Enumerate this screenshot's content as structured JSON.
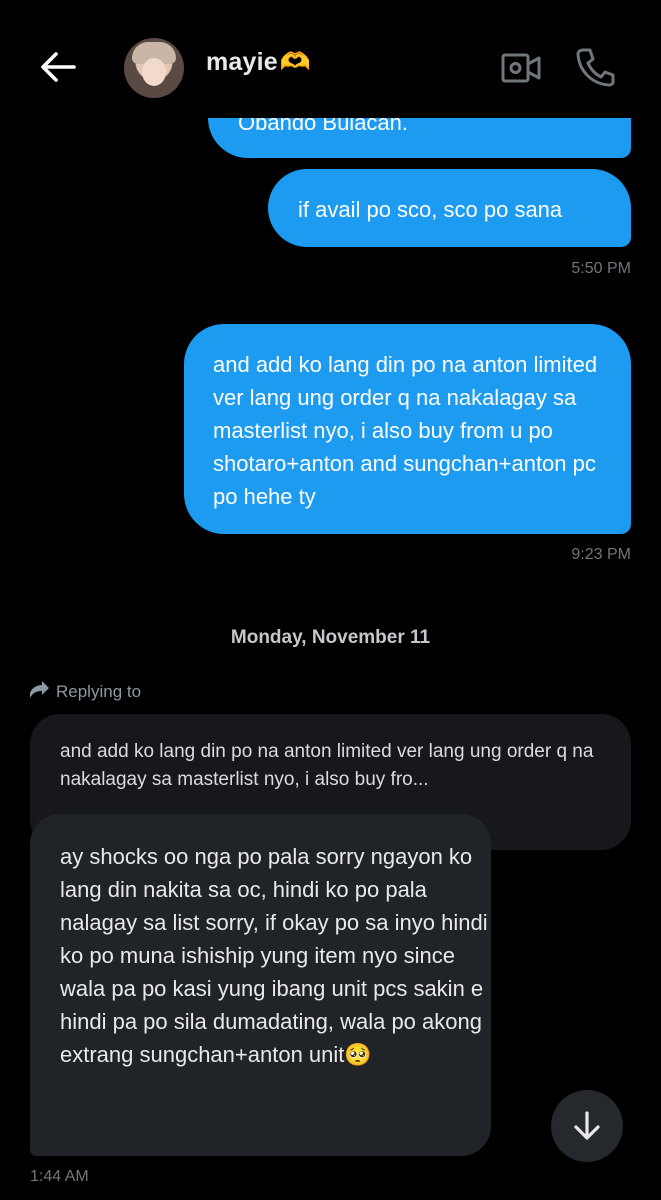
{
  "header": {
    "username": "mayie",
    "username_emoji": "🫶",
    "back_icon": "arrow-left-icon",
    "video_icon": "video-camera-icon",
    "call_icon": "phone-icon"
  },
  "messages": {
    "m1": {
      "text": "Obando Bulacan."
    },
    "m2": {
      "text": "if avail po sco, sco po sana",
      "time": "5:50 PM"
    },
    "m3": {
      "text": "and add ko lang din po na anton limited ver lang ung order q na nakalagay sa masterlist nyo, i also buy from u po shotaro+anton and sungchan+anton pc po hehe ty",
      "time": "9:23 PM"
    }
  },
  "date_separator": "Monday, November 11",
  "reply": {
    "label": "Replying to",
    "quoted": "and add ko lang din po na anton limited ver lang ung order q na nakalagay sa masterlist nyo, i also buy fro...",
    "text": "ay shocks oo nga po pala sorry ngayon ko lang din nakita sa oc, hindi ko po pala nalagay sa list sorry, if okay po sa inyo hindi ko po muna ishiship yung item nyo since wala pa po kasi yung ibang unit pcs sakin e hindi pa po sila dumadating, wala po akong extrang sungchan+anton unit🥺",
    "time": "1:44 AM"
  },
  "colors": {
    "background": "#000000",
    "outgoing_bubble": "#1d9bf0",
    "incoming_bubble": "#202327",
    "muted_text": "#71767b"
  }
}
